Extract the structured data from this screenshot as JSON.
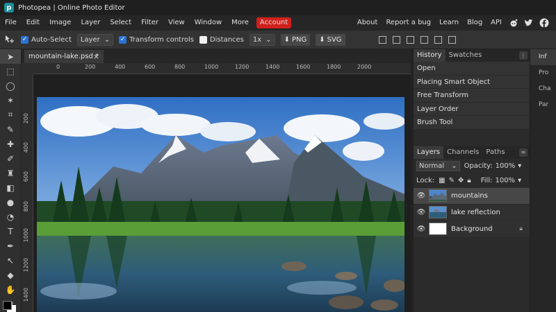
{
  "app": {
    "title": "Photopea | Online Photo Editor",
    "logo_char": "p"
  },
  "menubar": {
    "left": [
      "File",
      "Edit",
      "Image",
      "Layer",
      "Select",
      "Filter",
      "View",
      "Window",
      "More"
    ],
    "account": "Account",
    "right": [
      "About",
      "Report a bug",
      "Learn",
      "Blog",
      "API"
    ],
    "social_icons": [
      "reddit-icon",
      "twitter-icon",
      "facebook-icon"
    ]
  },
  "options": {
    "auto_select_label": "Auto-Select",
    "auto_select_checked": true,
    "target_value": "Layer",
    "transform_label": "Transform controls",
    "transform_checked": true,
    "distances_label": "Distances",
    "distances_checked": false,
    "zoom_value": "1x",
    "png_label": "PNG",
    "svg_label": "SVG"
  },
  "document": {
    "tab_name": "mountain-lake.psd *",
    "close_glyph": "×",
    "ruler_h": [
      "0",
      "200",
      "400",
      "600",
      "800",
      "1000",
      "1200",
      "1400",
      "1600",
      "1800",
      "2000"
    ],
    "ruler_v": [
      "200",
      "400",
      "600",
      "800",
      "1000",
      "1200",
      "1400"
    ]
  },
  "history": {
    "tabs": [
      "History",
      "Swatches"
    ],
    "items": [
      "Open",
      "Placing Smart Object",
      "Free Transform",
      "Layer Order",
      "Brush Tool"
    ]
  },
  "layers": {
    "tabs": [
      "Layers",
      "Channels",
      "Paths"
    ],
    "blend_mode": "Normal",
    "opacity_label": "Opacity:",
    "opacity_value": "100%",
    "lock_label": "Lock:",
    "fill_label": "Fill:",
    "fill_value": "100%",
    "items": [
      {
        "name": "mountains",
        "selected": true,
        "locked": false
      },
      {
        "name": "lake reflection",
        "selected": false,
        "locked": false
      },
      {
        "name": "Background",
        "selected": false,
        "locked": true
      }
    ]
  },
  "side_tabs": [
    "Inf",
    "Pro",
    "Cha",
    "Par"
  ],
  "colors": {
    "accent": "#d0201c",
    "checkbox": "#2b73d4",
    "panel_bg": "#2b2b2b"
  }
}
